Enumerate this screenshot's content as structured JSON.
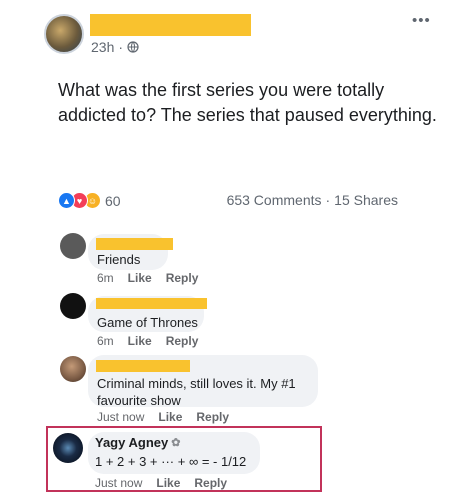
{
  "post": {
    "time": "23h",
    "separator": "·",
    "text": "What was the first series you were totally addicted to? The series that paused everything.",
    "reactions_count": "60",
    "comments_count": "653 Comments",
    "shares_count": "15 Shares",
    "dot": "·"
  },
  "comments": [
    {
      "text": "Friends",
      "time": "6m",
      "like": "Like",
      "reply": "Reply"
    },
    {
      "text": "Game of Thrones",
      "time": "6m",
      "like": "Like",
      "reply": "Reply"
    },
    {
      "text": "Criminal minds, still loves it. My #1 favourite show",
      "time": "Just now",
      "like": "Like",
      "reply": "Reply"
    },
    {
      "name": "Yagy Agney",
      "text": "1 + 2 + 3 + ··· + ∞ = - 1/12",
      "time": "Just now",
      "like": "Like",
      "reply": "Reply"
    }
  ],
  "icons": {
    "more": "more-options-icon",
    "globe": "globe-icon",
    "like": "like-reaction-icon",
    "love": "love-reaction-icon",
    "haha": "haha-reaction-icon",
    "badge": "badge-icon"
  },
  "colors": {
    "highlight_border": "#c2325a",
    "redaction": "#f9c22e",
    "like_blue": "#1877f2",
    "love_red": "#f33e58",
    "haha_yellow": "#f7b125"
  }
}
